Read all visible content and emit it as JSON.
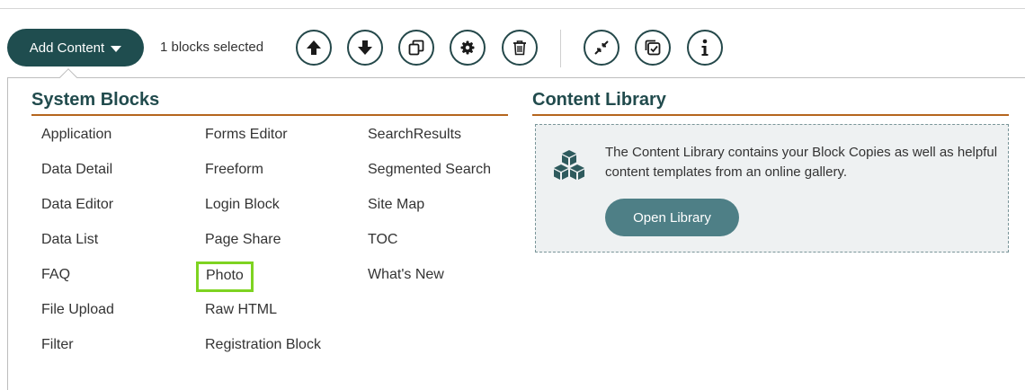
{
  "toolbar": {
    "add_content_label": "Add Content",
    "selection_text": "1 blocks selected",
    "tools": [
      {
        "name": "move-up-icon"
      },
      {
        "name": "move-down-icon"
      },
      {
        "name": "copy-icon"
      },
      {
        "name": "settings-icon"
      },
      {
        "name": "delete-icon"
      },
      {
        "name": "collapse-icon"
      },
      {
        "name": "select-all-icon"
      },
      {
        "name": "info-icon"
      }
    ]
  },
  "system_blocks": {
    "title": "System Blocks",
    "columns": [
      [
        "Application",
        "Data Detail",
        "Data Editor",
        "Data List",
        "FAQ",
        "File Upload",
        "Filter"
      ],
      [
        "Forms Editor",
        "Freeform",
        "Login Block",
        "Page Share",
        "Photo",
        "Raw HTML",
        "Registration Block"
      ],
      [
        "SearchResults",
        "Segmented Search",
        "Site Map",
        "TOC",
        "What's New"
      ]
    ],
    "highlighted_item": "Photo"
  },
  "content_library": {
    "title": "Content Library",
    "description": "The Content Library contains your Block Copies as well as helpful content templates from an online gallery.",
    "button_label": "Open Library",
    "icon": "cubes-icon"
  },
  "colors": {
    "primary": "#1f4d4f",
    "accent_rule": "#b5651d",
    "library_button": "#4e7f86",
    "highlight": "#7ed321"
  }
}
